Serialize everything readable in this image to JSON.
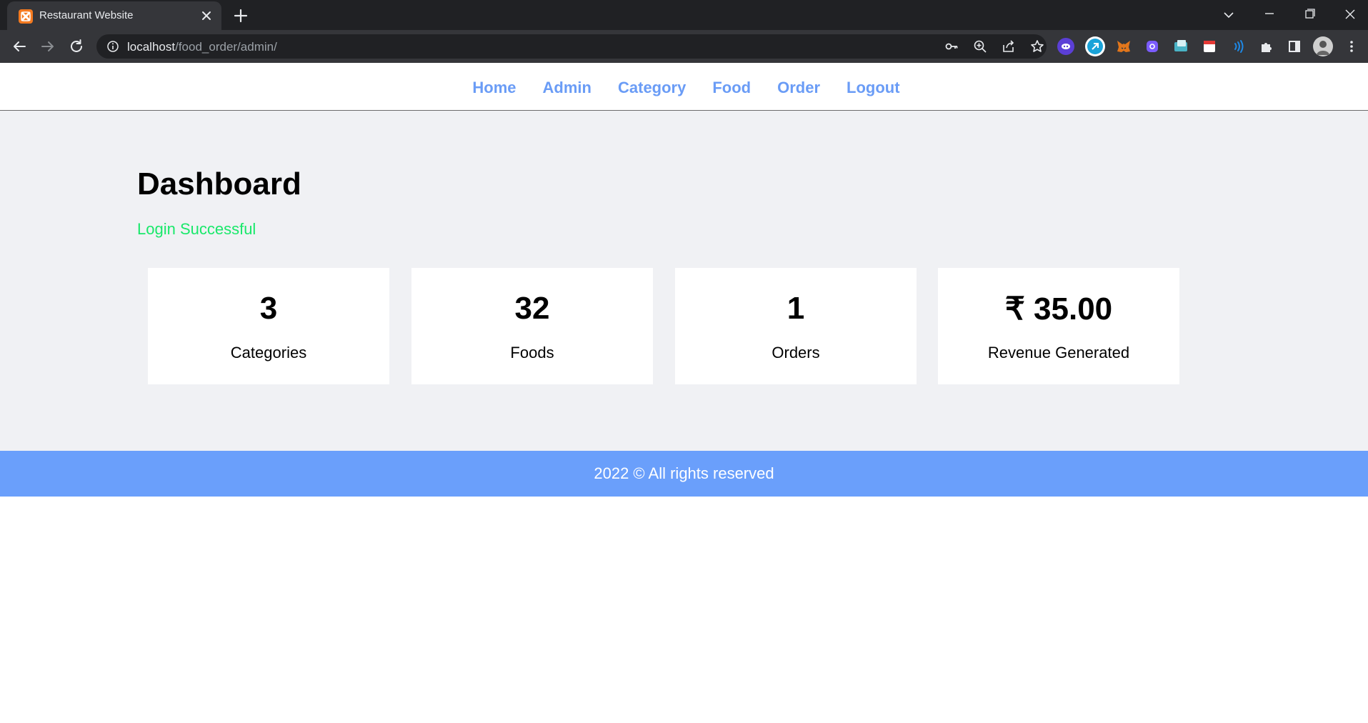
{
  "browser": {
    "tab_title": "Restaurant Website",
    "url_host": "localhost",
    "url_path": "/food_order/admin/"
  },
  "nav": {
    "items": [
      {
        "label": "Home"
      },
      {
        "label": "Admin"
      },
      {
        "label": "Category"
      },
      {
        "label": "Food"
      },
      {
        "label": "Order"
      },
      {
        "label": "Logout"
      }
    ]
  },
  "dashboard": {
    "title": "Dashboard",
    "message": "Login Successful",
    "cards": [
      {
        "value": "3",
        "label": "Categories"
      },
      {
        "value": "32",
        "label": "Foods"
      },
      {
        "value": "1",
        "label": "Orders"
      },
      {
        "value": "₹ 35.00",
        "label": "Revenue Generated"
      }
    ]
  },
  "footer": {
    "text": "2022 © All rights reserved"
  },
  "colors": {
    "nav_link": "#6a9cf6",
    "success": "#19e86a",
    "footer_bg": "#6a9ffb",
    "main_bg": "#f0f1f4"
  }
}
